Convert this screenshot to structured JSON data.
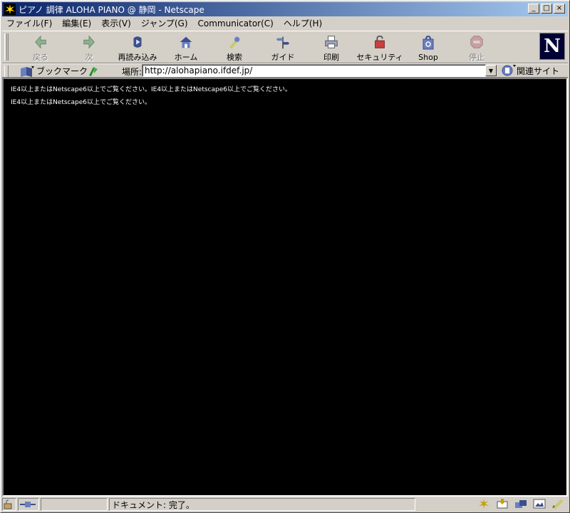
{
  "window": {
    "title": "ピアノ 調律 ALOHA PIANO @ 静岡 - Netscape",
    "minimize_glyph": "_",
    "maximize_glyph": "□",
    "close_glyph": "×"
  },
  "menubar": {
    "items": [
      {
        "label": "ファイル(F)"
      },
      {
        "label": "編集(E)"
      },
      {
        "label": "表示(V)"
      },
      {
        "label": "ジャンプ(G)"
      },
      {
        "label": "Communicator(C)"
      },
      {
        "label": "ヘルプ(H)"
      }
    ]
  },
  "toolbar": {
    "back": "戻る",
    "forward": "次",
    "reload": "再読み込み",
    "home": "ホーム",
    "search": "検索",
    "guide": "ガイド",
    "print": "印刷",
    "security": "セキュリティ",
    "shop": "Shop",
    "stop": "停止",
    "logo_letter": "N"
  },
  "location": {
    "bookmarks_label": "ブックマーク",
    "location_label": "場所:",
    "url": "http://alohapiano.ifdef.jp/",
    "related_label": "関連サイト"
  },
  "content": {
    "lines": [
      "IE4以上またはNetscape6以上でご覧ください。IE4以上またはNetscape6以上でご覧ください。",
      "IE4以上またはNetscape6以上でご覧ください。"
    ]
  },
  "status": {
    "text": "ドキュメント: 完了。"
  },
  "colors": {
    "titlebar_start": "#0a246a",
    "titlebar_end": "#a6caf0",
    "chrome": "#d4d0c8",
    "content_bg": "#000000"
  }
}
